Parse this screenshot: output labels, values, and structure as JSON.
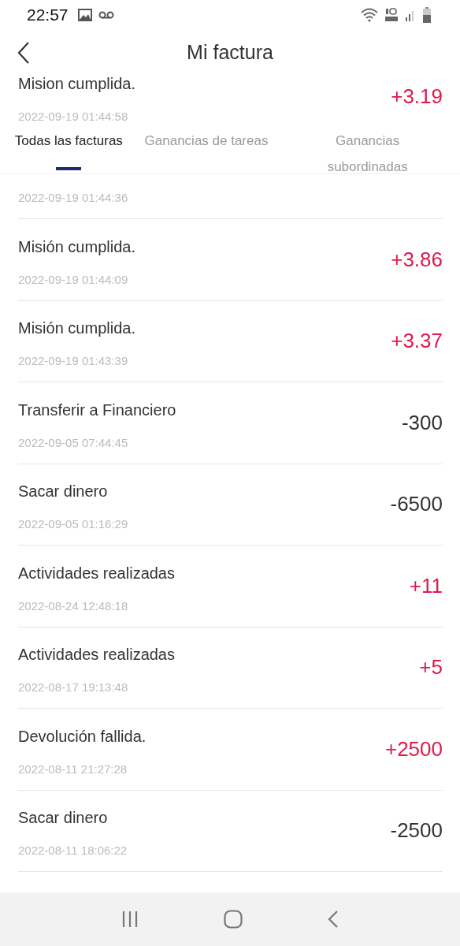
{
  "status_bar": {
    "time": "22:57"
  },
  "header": {
    "title": "Mi factura"
  },
  "tabs": [
    {
      "label": "Todas las facturas",
      "selected": true
    },
    {
      "label": "Ganancias de tareas",
      "selected": false
    },
    {
      "label": "Ganancias subordinadas",
      "selected": false
    }
  ],
  "transactions": [
    {
      "title": "Mision cumplida.",
      "date": "2022-09-19 01:44:58",
      "amount": "+3.19",
      "kind": "credit"
    },
    {
      "date": "2022-09-19 01:44:36"
    },
    {
      "title": "Misión cumplida.",
      "date": "2022-09-19 01:44:09",
      "amount": "+3.86",
      "kind": "credit"
    },
    {
      "title": "Misión cumplida.",
      "date": "2022-09-19 01:43:39",
      "amount": "+3.37",
      "kind": "credit"
    },
    {
      "title": "Transferir a Financiero",
      "date": "2022-09-05 07:44:45",
      "amount": "-300",
      "kind": "debit"
    },
    {
      "title": "Sacar dinero",
      "date": "2022-09-05 01:16:29",
      "amount": "-6500",
      "kind": "debit"
    },
    {
      "title": "Actividades realizadas",
      "date": "2022-08-24 12:48:18",
      "amount": "+11",
      "kind": "credit"
    },
    {
      "title": "Actividades realizadas",
      "date": "2022-08-17 19:13:48",
      "amount": "+5",
      "kind": "credit"
    },
    {
      "title": "Devolución fallida.",
      "date": "2022-08-11 21:27:28",
      "amount": "+2500",
      "kind": "credit"
    },
    {
      "title": "Sacar dinero",
      "date": "2022-08-11 18:06:22",
      "amount": "-2500",
      "kind": "debit"
    }
  ]
}
